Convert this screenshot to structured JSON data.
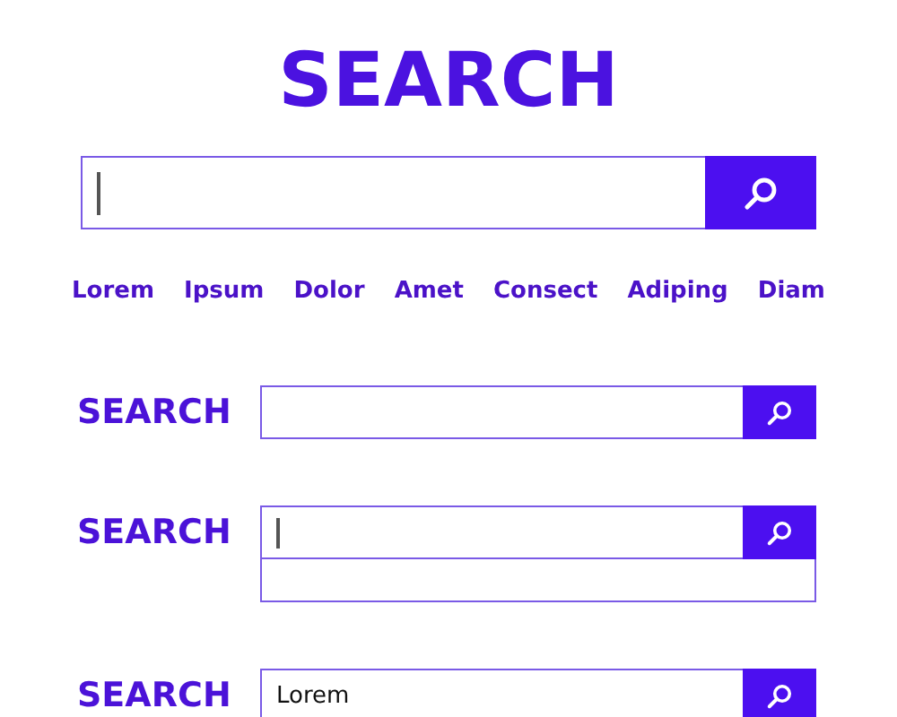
{
  "title": "SEARCH",
  "main_search": {
    "focused": true
  },
  "tags": [
    "Lorem",
    "Ipsum",
    "Dolor",
    "Amet",
    "Consect",
    "Adiping",
    "Diam"
  ],
  "search_rows": [
    {
      "label": "SEARCH",
      "focused": false,
      "expanded": false
    },
    {
      "label": "SEARCH",
      "focused": true,
      "expanded": true
    },
    {
      "label": "SEARCH",
      "focused": false,
      "value": "Lorem"
    }
  ]
}
